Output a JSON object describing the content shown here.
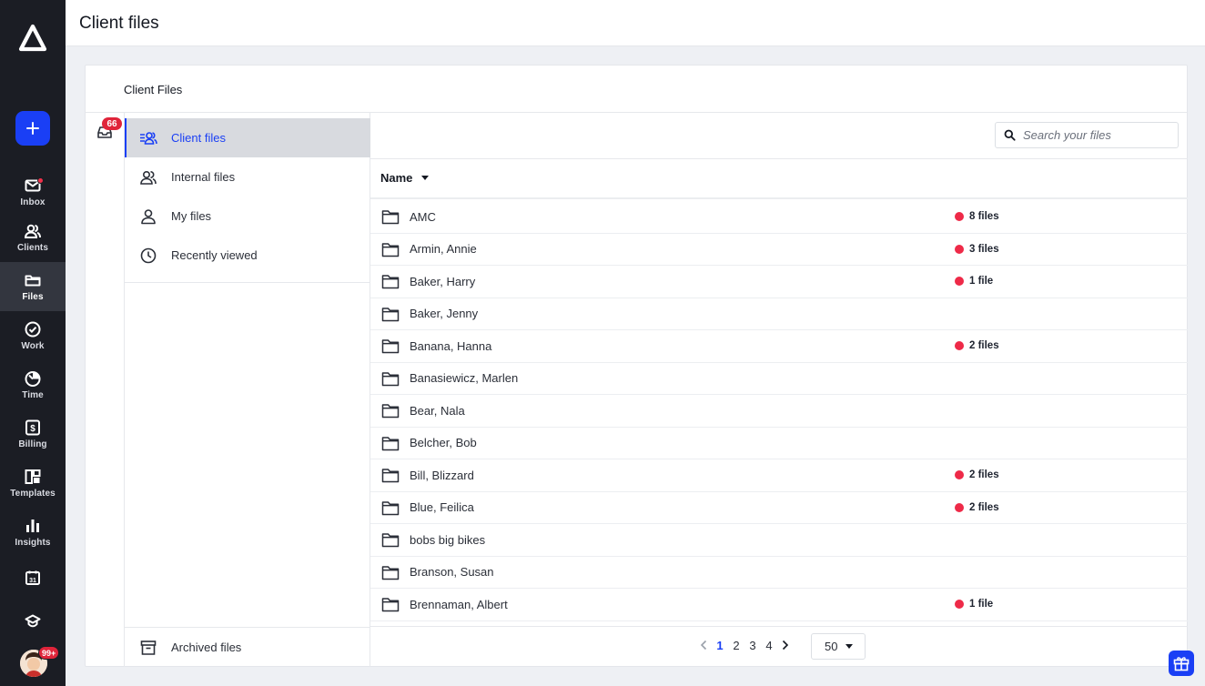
{
  "app": {
    "page_title": "Client files"
  },
  "nav": {
    "items": [
      {
        "id": "inbox",
        "label": "Inbox",
        "icon": "mail-icon"
      },
      {
        "id": "clients",
        "label": "Clients",
        "icon": "people-icon"
      },
      {
        "id": "files",
        "label": "Files",
        "icon": "folder-icon",
        "active": true
      },
      {
        "id": "work",
        "label": "Work",
        "icon": "check-circle-icon"
      },
      {
        "id": "time",
        "label": "Time",
        "icon": "timer-icon"
      },
      {
        "id": "billing",
        "label": "Billing",
        "icon": "dollar-icon"
      },
      {
        "id": "templates",
        "label": "Templates",
        "icon": "layout-icon"
      },
      {
        "id": "insights",
        "label": "Insights",
        "icon": "bar-chart-icon"
      }
    ],
    "calendar_day": "31",
    "avatar_badge": "99+"
  },
  "card": {
    "title": "Client Files",
    "inbox_badge": "66"
  },
  "sidebar": {
    "items": [
      {
        "label": "Client files",
        "icon": "client-files-icon",
        "active": true
      },
      {
        "label": "Internal files",
        "icon": "people-icon"
      },
      {
        "label": "My files",
        "icon": "person-icon"
      },
      {
        "label": "Recently viewed",
        "icon": "clock-icon"
      }
    ],
    "archived_label": "Archived files"
  },
  "search": {
    "placeholder": "Search your files"
  },
  "table": {
    "column_name": "Name",
    "rows": [
      {
        "name": "AMC",
        "count": "8 files"
      },
      {
        "name": "Armin, Annie",
        "count": "3 files"
      },
      {
        "name": "Baker, Harry",
        "count": "1 file"
      },
      {
        "name": "Baker, Jenny",
        "count": ""
      },
      {
        "name": "Banana, Hanna",
        "count": "2 files"
      },
      {
        "name": "Banasiewicz, Marlen",
        "count": ""
      },
      {
        "name": "Bear, Nala",
        "count": ""
      },
      {
        "name": "Belcher, Bob",
        "count": ""
      },
      {
        "name": "Bill, Blizzard",
        "count": "2 files"
      },
      {
        "name": "Blue, Feilica",
        "count": "2 files"
      },
      {
        "name": "bobs big bikes",
        "count": ""
      },
      {
        "name": "Branson, Susan",
        "count": ""
      },
      {
        "name": "Brennaman, Albert",
        "count": "1 file"
      }
    ]
  },
  "pagination": {
    "pages": [
      "1",
      "2",
      "3",
      "4"
    ],
    "current": "1",
    "per_page": "50"
  },
  "colors": {
    "accent": "#1a3ff5",
    "badge": "#e0243a",
    "dot": "#ee2a48",
    "nav_bg": "#1b1d24"
  }
}
